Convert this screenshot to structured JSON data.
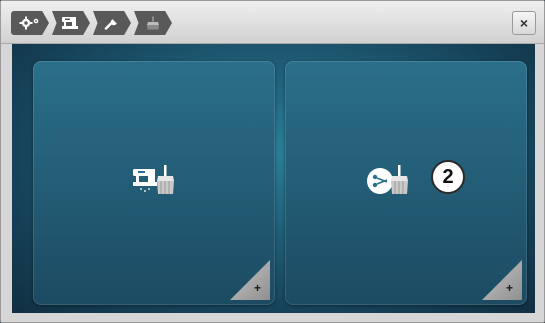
{
  "breadcrumb": {
    "items": [
      {
        "icon": "settings-icon"
      },
      {
        "icon": "sewing-machine-icon"
      },
      {
        "icon": "wrench-icon"
      },
      {
        "icon": "cleaning-brush-icon"
      }
    ]
  },
  "toolbar": {
    "close_label": "×"
  },
  "tiles": [
    {
      "icon": "machine-cleaning-icon",
      "corner_label": "+"
    },
    {
      "icon": "hook-cleaning-icon",
      "corner_label": "+",
      "badge": "2"
    }
  ],
  "colors": {
    "breadcrumb_bg": "#595959",
    "content_bg": "#1f5f78",
    "tile_bg": "#2b6f8a",
    "badge_bg": "#ffffff"
  }
}
